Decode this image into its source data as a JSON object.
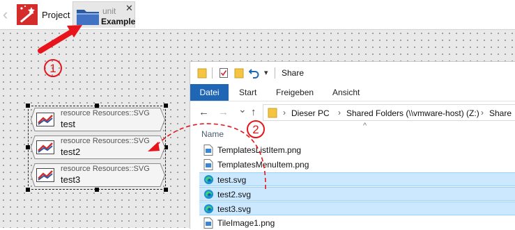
{
  "tabbar": {
    "project_label": "Project",
    "unit_tab": {
      "subtitle": "unit",
      "title": "Example",
      "close_glyph": "✕"
    }
  },
  "designer": {
    "items": [
      {
        "type_label": "resource Resources::SVG",
        "name": "test"
      },
      {
        "type_label": "resource Resources::SVG",
        "name": "test2"
      },
      {
        "type_label": "resource Resources::SVG",
        "name": "test3"
      }
    ]
  },
  "annotations": {
    "step1": "1",
    "step2": "2",
    "arrow_color": "#e8141c"
  },
  "explorer": {
    "window_title": "Share",
    "quick_access_dropdown": "▾",
    "ribbon_tabs": [
      "Datei",
      "Start",
      "Freigeben",
      "Ansicht"
    ],
    "active_tab_color": "#1f67b5",
    "nav": {
      "back": "←",
      "forward": "→",
      "recent": "⌄",
      "up": "↑"
    },
    "breadcrumb": [
      "Dieser PC",
      "Shared Folders (\\\\vmware-host) (Z:)",
      "Share"
    ],
    "breadcrumb_separator": "›",
    "column_header": "Name",
    "sort_caret": "^",
    "files": [
      {
        "name": "TemplatesListItem.png",
        "icon": "png-file-icon",
        "selected": false
      },
      {
        "name": "TemplatesMenuItem.png",
        "icon": "png-file-icon",
        "selected": false
      },
      {
        "name": "test.svg",
        "icon": "edge-svg-icon",
        "selected": true
      },
      {
        "name": "test2.svg",
        "icon": "edge-svg-icon",
        "selected": true
      },
      {
        "name": "test3.svg",
        "icon": "edge-svg-icon",
        "selected": true
      },
      {
        "name": "TileImage1.png",
        "icon": "png-file-icon",
        "selected": false
      }
    ],
    "selection_color": "#cce8ff"
  }
}
